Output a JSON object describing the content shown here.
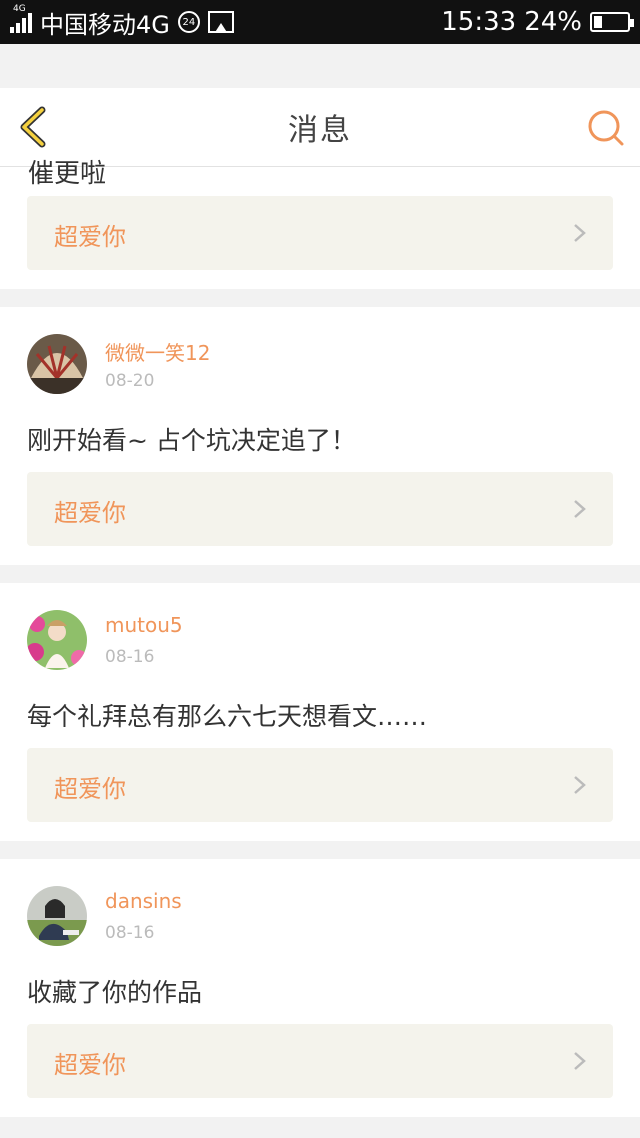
{
  "status_bar": {
    "carrier": "中国移动4G",
    "sim_tag": "4G",
    "badge": "24",
    "time": "15:33",
    "battery": "24%",
    "battery_level": 0.24
  },
  "nav": {
    "title": "消息",
    "back_icon": "back-chevron-icon",
    "search_icon": "search-icon"
  },
  "accent_color": "#f0955a",
  "top_card": {
    "partial_text": "催更啦",
    "reply_label": "超爱你"
  },
  "messages": [
    {
      "username": "微微一笑12",
      "date": "08-20",
      "text": "刚开始看~ 占个坑决定追了！",
      "reply_label": "超爱你"
    },
    {
      "username": "mutou5",
      "date": "08-16",
      "text": "每个礼拜总有那么六七天想看文……",
      "reply_label": "超爱你"
    },
    {
      "username": "dansins",
      "date": "08-16",
      "text": "收藏了你的作品",
      "reply_label": "超爱你"
    }
  ]
}
